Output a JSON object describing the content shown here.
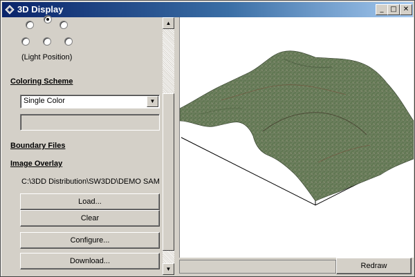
{
  "window": {
    "title": "3D Display",
    "minimize_glyph": "_",
    "maximize_glyph": "□",
    "close_glyph": "✕"
  },
  "left": {
    "light_position_label": "(Light Position)",
    "coloring_scheme_heading": "Coloring Scheme",
    "coloring_scheme_value": "Single Color",
    "boundary_files_heading": "Boundary Files",
    "image_overlay_heading": "Image Overlay",
    "image_overlay_path": "C:\\3DD Distribution\\SW3DD\\DEMO SAM",
    "load_label": "Load...",
    "clear_label": "Clear",
    "configure_label": "Configure...",
    "download_label": "Download..."
  },
  "footer": {
    "redraw_label": "Redraw"
  },
  "colors": {
    "titlebar_start": "#0a246a",
    "titlebar_end": "#a6caf0",
    "face": "#d4d0c8"
  }
}
